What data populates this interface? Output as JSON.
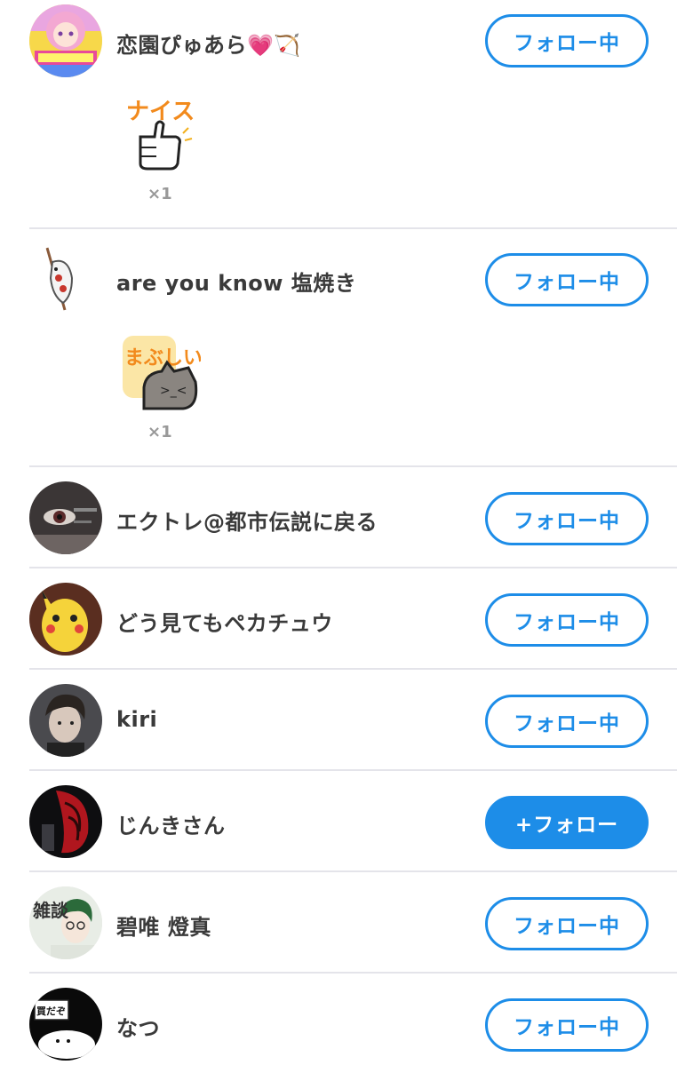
{
  "follow_list": [
    {
      "name": "恋園ぴゅあら💗🏹",
      "button": "フォロー中",
      "following": true,
      "avatar_icon": "anime-girl-pink-hair-avatar",
      "reaction": {
        "sticker_text": "ナイス",
        "sticker_icon": "thumbs-up-sticker",
        "count": "×1"
      }
    },
    {
      "name": "are you know 塩焼き",
      "button": "フォロー中",
      "following": true,
      "avatar_icon": "grilled-fish-on-stick-avatar",
      "reaction": {
        "sticker_text": "まぶしい",
        "sticker_icon": "squinting-cat-sticker",
        "count": "×1"
      }
    },
    {
      "name": "エクトレ@都市伝説に戻る",
      "button": "フォロー中",
      "following": true,
      "avatar_icon": "dark-eye-closeup-avatar"
    },
    {
      "name": "どう見てもペカチュウ",
      "button": "フォロー中",
      "following": true,
      "avatar_icon": "yellow-pikachu-avatar"
    },
    {
      "name": "kiri",
      "button": "フォロー中",
      "following": true,
      "avatar_icon": "dark-haired-man-avatar"
    },
    {
      "name": "じんきさん",
      "button": "+フォロー",
      "following": false,
      "avatar_icon": "red-mechanical-avatar"
    },
    {
      "name": "碧唯 燈真",
      "button": "フォロー中",
      "following": true,
      "avatar_icon": "green-haired-boy-zatsudan-avatar",
      "avatar_text": "雑談"
    },
    {
      "name": "なつ",
      "button": "フォロー中",
      "following": true,
      "avatar_icon": "white-seal-sign-avatar",
      "avatar_text": "買だぞ"
    }
  ],
  "colors": {
    "accent": "#1d8de8",
    "divider": "#e4e4ea",
    "name_text": "#3a3a3a",
    "count_text": "#999999"
  }
}
